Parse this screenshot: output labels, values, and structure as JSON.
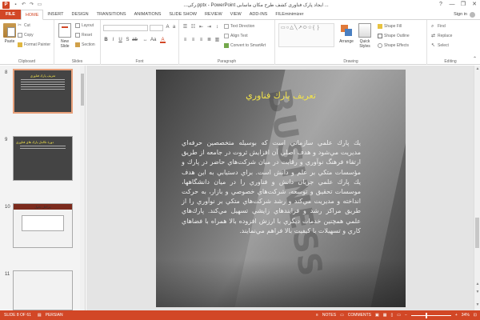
{
  "window": {
    "title": "...رکی.pptx - PowerPoint ایجاد پارک فناوری کشف طرح مکان ماسابی ...",
    "controls": [
      "?",
      "—",
      "❐",
      "✕"
    ]
  },
  "tabs": [
    "FILE",
    "HOME",
    "INSERT",
    "DESIGN",
    "TRANSITIONS",
    "ANIMATIONS",
    "SLIDE SHOW",
    "REVIEW",
    "VIEW",
    "ADD-INS",
    "FILEminimizer"
  ],
  "active_tab": "HOME",
  "account": {
    "sign_in": "Sign in"
  },
  "ribbon": {
    "clipboard": {
      "label": "Clipboard",
      "paste": "Paste",
      "cut": "Cut",
      "copy": "Copy",
      "format_painter": "Format Painter"
    },
    "slides": {
      "label": "Slides",
      "new_slide": "New Slide",
      "layout": "Layout",
      "reset": "Reset",
      "section": "Section"
    },
    "font": {
      "label": "Font"
    },
    "paragraph": {
      "label": "Paragraph",
      "text_direction": "Text Direction",
      "align_text": "Align Text",
      "convert_smartart": "Convert to SmartArt"
    },
    "drawing": {
      "label": "Drawing",
      "arrange": "Arrange",
      "quick_styles": "Quick Styles",
      "shape_fill": "Shape Fill",
      "shape_outline": "Shape Outline",
      "shape_effects": "Shape Effects"
    },
    "editing": {
      "label": "Editing",
      "find": "Find",
      "replace": "Replace",
      "select": "Select"
    }
  },
  "thumbnails": [
    {
      "num": "8",
      "title": "تعريف پارك فناوري",
      "selected": true
    },
    {
      "num": "9",
      "title": "دورة تكامل پارك هاي فناوري",
      "selected": false
    },
    {
      "num": "10",
      "title": "مراحل تحول",
      "selected": false
    },
    {
      "num": "11",
      "title": "",
      "selected": false
    }
  ],
  "slide": {
    "title": "تعريف پارك فناوري",
    "body": "يك پارك علمي سازماني است كه بوسيله متخصصين حرفه‌اي مديريت مي‌شود و هدف اصلي آن افزايش ثروت در جامعه از طريق ارتقاء فرهنگ نوآوري و رقابت در ميان شركت‌هاي حاضر در پارك و مؤسسات متكي بر علم و دانش است. براي دستيابي به اين هدف يك پارك علمي جريان دانش و فناوري را در ميان دانشگاهها، موسسات تحقيق و توسعه، شركت‌هاي خصوصي و بازار، به حركت انداخته و مديريت مي‌كند و رشد شركت‌هاي متكي بر نوآوري را از طريق مراكز رشد و فرايندهاي زايشي تسهيل مي‌كند. پارك‌هاي علمي همچنين خدمات ديگري با ارزش افزوده بالا همراه با فضاهاي كاري و تسهيلات با كيفيت بالا فراهم مي‌نمايند."
  },
  "status": {
    "slide_of": "SLIDE 8 OF 61",
    "language": "PERSIAN",
    "notes": "NOTES",
    "comments": "COMMENTS",
    "zoom": "34%"
  },
  "colors": {
    "accent": "#d24726",
    "title_yellow": "#f3e44a"
  }
}
